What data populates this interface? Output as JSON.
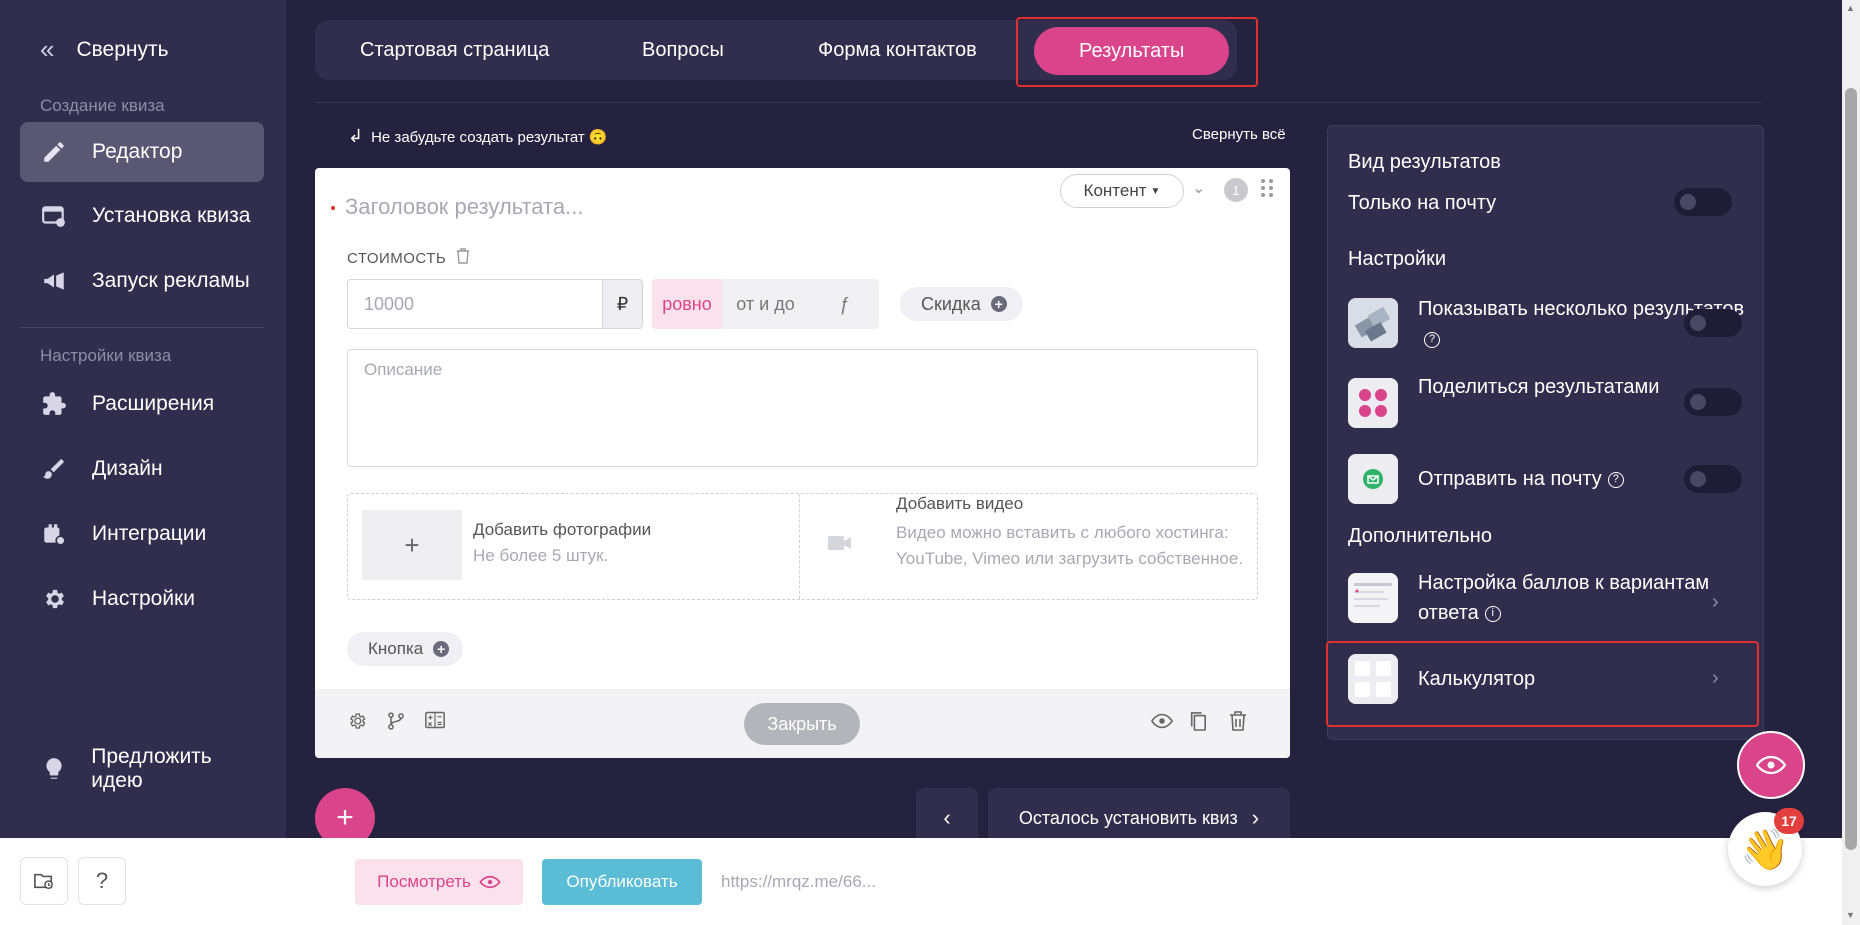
{
  "sidebar": {
    "collapse_label": "Свернуть",
    "section_create": "Создание квиза",
    "items_create": [
      {
        "label": "Редактор",
        "icon": "pencil-icon",
        "active": true
      },
      {
        "label": "Установка квиза",
        "icon": "install-icon"
      },
      {
        "label": "Запуск рекламы",
        "icon": "megaphone-icon"
      }
    ],
    "section_settings": "Настройки квиза",
    "items_settings": [
      {
        "label": "Расширения",
        "icon": "puzzle-icon"
      },
      {
        "label": "Дизайн",
        "icon": "brush-icon"
      },
      {
        "label": "Интеграции",
        "icon": "integrations-icon"
      },
      {
        "label": "Настройки",
        "icon": "gear-icon"
      }
    ],
    "suggest_label": "Предложить идею"
  },
  "tabs": [
    {
      "label": "Стартовая страница"
    },
    {
      "label": "Вопросы"
    },
    {
      "label": "Форма контактов"
    },
    {
      "label": "Результаты",
      "active": true
    }
  ],
  "hint": "Не забудьте создать результат 🙃",
  "collapse_all": "Свернуть всё",
  "card": {
    "title_placeholder": "Заголовок результата...",
    "content_button": "Контент",
    "number": "1",
    "cost_label": "СТОИМОСТЬ",
    "price_placeholder": "10000",
    "currency": "₽",
    "modes": [
      "ровно",
      "от и до",
      "ƒ"
    ],
    "discount_label": "Скидка",
    "description_placeholder": "Описание",
    "add_photo_title": "Добавить фотографии",
    "add_photo_sub": "Не более 5 штук.",
    "add_video_title": "Добавить видео",
    "add_video_sub": "Видео можно вставить с любого хостинга: YouTube, Vimeo или загрузить собственное.",
    "button_chip": "Кнопка",
    "close_label": "Закрыть"
  },
  "panel": {
    "view_heading": "Вид результатов",
    "email_only": "Только на почту",
    "settings_heading": "Настройки",
    "show_multiple": "Показывать несколько результатов",
    "share_results": "Поделиться результатами",
    "send_email": "Отправить на почту",
    "extra_heading": "Дополнительно",
    "scoring": "Настройка баллов к вариантам ответа",
    "calculator": "Калькулятор"
  },
  "bottom_nav": {
    "next_label": "Осталось установить квиз"
  },
  "bottom_bar": {
    "help": "?",
    "preview_label": "Посмотреть",
    "publish_label": "Опубликовать",
    "url": "https://mrqz.me/66..."
  },
  "chat": {
    "badge": "17"
  },
  "colors": {
    "accent": "#d9448a",
    "sidebar_bg": "#312e4d",
    "page_bg": "#25223f",
    "publish": "#5bbcd6"
  }
}
